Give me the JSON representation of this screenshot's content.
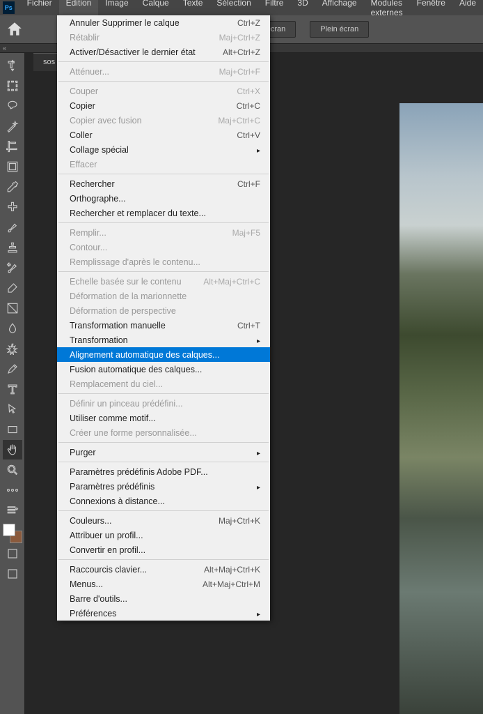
{
  "menubar": {
    "items": [
      "Fichier",
      "Edition",
      "Image",
      "Calque",
      "Texte",
      "Sélection",
      "Filtre",
      "3D",
      "Affichage",
      "Modules externes",
      "Fenêtre",
      "Aide"
    ],
    "open_index": 1
  },
  "optionbar": {
    "btn1": "à l'écran",
    "btn2": "Plein écran"
  },
  "doc_tab": "sos",
  "dropdown": [
    {
      "label": "Annuler Supprimer le calque",
      "shortcut": "Ctrl+Z"
    },
    {
      "label": "Rétablir",
      "shortcut": "Maj+Ctrl+Z",
      "disabled": true
    },
    {
      "label": "Activer/Désactiver le dernier état",
      "shortcut": "Alt+Ctrl+Z"
    },
    {
      "sep": true
    },
    {
      "label": "Atténuer...",
      "shortcut": "Maj+Ctrl+F",
      "disabled": true
    },
    {
      "sep": true
    },
    {
      "label": "Couper",
      "shortcut": "Ctrl+X",
      "disabled": true
    },
    {
      "label": "Copier",
      "shortcut": "Ctrl+C"
    },
    {
      "label": "Copier avec fusion",
      "shortcut": "Maj+Ctrl+C",
      "disabled": true
    },
    {
      "label": "Coller",
      "shortcut": "Ctrl+V"
    },
    {
      "label": "Collage spécial",
      "submenu": true
    },
    {
      "label": "Effacer",
      "disabled": true
    },
    {
      "sep": true
    },
    {
      "label": "Rechercher",
      "shortcut": "Ctrl+F"
    },
    {
      "label": "Orthographe..."
    },
    {
      "label": "Rechercher et remplacer du texte..."
    },
    {
      "sep": true
    },
    {
      "label": "Remplir...",
      "shortcut": "Maj+F5",
      "disabled": true
    },
    {
      "label": "Contour...",
      "disabled": true
    },
    {
      "label": "Remplissage d'après le contenu...",
      "disabled": true
    },
    {
      "sep": true
    },
    {
      "label": "Echelle basée sur le contenu",
      "shortcut": "Alt+Maj+Ctrl+C",
      "disabled": true
    },
    {
      "label": "Déformation de la marionnette",
      "disabled": true
    },
    {
      "label": "Déformation de perspective",
      "disabled": true
    },
    {
      "label": "Transformation manuelle",
      "shortcut": "Ctrl+T"
    },
    {
      "label": "Transformation",
      "submenu": true
    },
    {
      "label": "Alignement automatique des calques...",
      "highlighted": true
    },
    {
      "label": "Fusion automatique des calques..."
    },
    {
      "label": "Remplacement du ciel...",
      "disabled": true
    },
    {
      "sep": true
    },
    {
      "label": "Définir un pinceau prédéfini...",
      "disabled": true
    },
    {
      "label": "Utiliser comme motif..."
    },
    {
      "label": "Créer une forme personnalisée...",
      "disabled": true
    },
    {
      "sep": true
    },
    {
      "label": "Purger",
      "submenu": true
    },
    {
      "sep": true
    },
    {
      "label": "Paramètres prédéfinis Adobe PDF..."
    },
    {
      "label": "Paramètres prédéfinis",
      "submenu": true
    },
    {
      "label": "Connexions à distance..."
    },
    {
      "sep": true
    },
    {
      "label": "Couleurs...",
      "shortcut": "Maj+Ctrl+K"
    },
    {
      "label": "Attribuer un profil..."
    },
    {
      "label": "Convertir en profil..."
    },
    {
      "sep": true
    },
    {
      "label": "Raccourcis clavier...",
      "shortcut": "Alt+Maj+Ctrl+K"
    },
    {
      "label": "Menus...",
      "shortcut": "Alt+Maj+Ctrl+M"
    },
    {
      "label": "Barre d'outils..."
    },
    {
      "label": "Préférences",
      "submenu": true
    }
  ],
  "tools": [
    "move",
    "marquee",
    "lasso",
    "wand",
    "crop",
    "frame",
    "eyedropper",
    "healing",
    "brush",
    "stamp",
    "history-brush",
    "eraser",
    "gradient",
    "blur",
    "dodge",
    "pen",
    "type",
    "path-select",
    "rectangle",
    "hand",
    "zoom",
    "more",
    "edit-toolbar"
  ]
}
